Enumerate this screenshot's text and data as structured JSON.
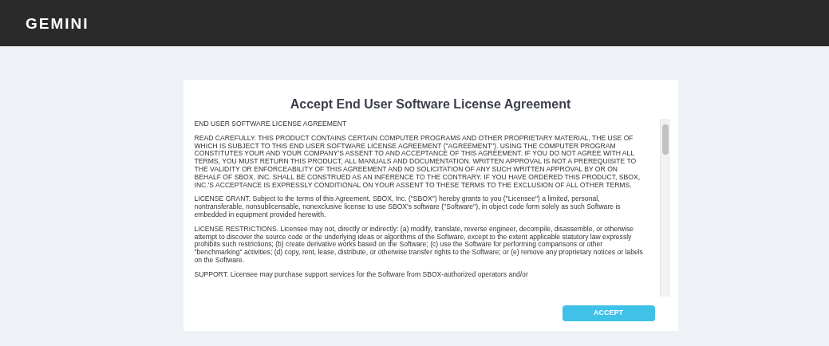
{
  "header": {
    "logo": "GEMINI"
  },
  "dialog": {
    "title": "Accept End User Software License Agreement",
    "paragraphs": [
      "END USER SOFTWARE LICENSE AGREEMENT",
      "READ CAREFULLY. THIS PRODUCT CONTAINS CERTAIN COMPUTER PROGRAMS AND OTHER PROPRIETARY MATERIAL, THE USE OF WHICH IS SUBJECT TO THIS END USER SOFTWARE LICENSE AGREEMENT (\"AGREEMENT\"). USING THE COMPUTER PROGRAM CONSTITUTES YOUR AND YOUR COMPANY'S ASSENT TO AND ACCEPTANCE OF THIS AGREEMENT. IF YOU DO NOT AGREE WITH ALL TERMS, YOU MUST RETURN THIS PRODUCT, ALL MANUALS AND DOCUMENTATION. WRITTEN APPROVAL IS NOT A PREREQUISITE TO THE VALIDITY OR ENFORCEABILITY OF THIS AGREEMENT AND NO SOLICITATION OF ANY SUCH WRITTEN APPROVAL BY OR ON BEHALF OF SBOX, INC. SHALL BE CONSTRUED AS AN INFERENCE TO THE CONTRARY. IF YOU HAVE ORDERED THIS PRODUCT, SBOX, INC.'S ACCEPTANCE IS EXPRESSLY CONDITIONAL ON YOUR ASSENT TO THESE TERMS TO THE EXCLUSION OF ALL OTHER TERMS.",
      "LICENSE GRANT. Subject to the terms of this Agreement, SBOX, Inc. (\"SBOX\") hereby grants to you (\"Licensee\") a limited, personal, nontransferable, nonsublicensable, nonexclusive license to use SBOX's software (\"Software\"), in object code form solely as such Software is embedded in equipment provided herewith.",
      "LICENSE RESTRICTIONS. Licensee may not, directly or indirectly: (a) modify, translate, reverse engineer, decompile, disassemble, or otherwise attempt to discover the source code or the underlying ideas or algorithms of the Software, except to the extent applicable statutory law expressly prohibits such restrictions; (b) create derivative works based on the Software; (c) use the Software for performing comparisons or other \"benchmarking\" activities; (d) copy, rent, lease, distribute, or otherwise transfer rights to the Software; or (e) remove any proprietary notices or labels on the Software.",
      "SUPPORT. Licensee may purchase support services for the Software from SBOX-authorized operators and/or"
    ],
    "button": "ACCEPT"
  }
}
